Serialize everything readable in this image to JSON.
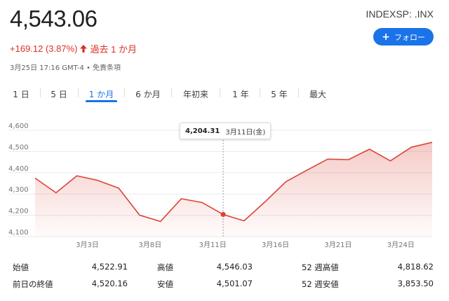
{
  "header": {
    "price": "4,543.06",
    "ticker": "INDEXSP: .INX",
    "follow_label": "フォロー",
    "change_text": "+169.12 (3.87%)",
    "change_period": "過去 1 か月",
    "timestamp": "3月25日 17:16 GMT-4 • 免責条項"
  },
  "tabs": [
    {
      "label": "1 日"
    },
    {
      "label": "5 日"
    },
    {
      "label": "1 か月",
      "active": true
    },
    {
      "label": "6 か月"
    },
    {
      "label": "年初来"
    },
    {
      "label": "1 年"
    },
    {
      "label": "5 年"
    },
    {
      "label": "最大"
    }
  ],
  "tooltip": {
    "value": "4,204.31",
    "date": "3月11日(金)"
  },
  "colors": {
    "line": "#db4437",
    "accent": "#1a73e8",
    "down_text": "#d93025"
  },
  "chart_data": {
    "type": "area",
    "x": [
      "2/25",
      "2/28",
      "3/1",
      "3/2",
      "3/3",
      "3/4",
      "3/7",
      "3/8",
      "3/9",
      "3/10",
      "3/11",
      "3/14",
      "3/15",
      "3/16",
      "3/17",
      "3/18",
      "3/21",
      "3/22",
      "3/23",
      "3/24",
      "3/25"
    ],
    "values": [
      4375,
      4306,
      4386,
      4364,
      4328,
      4201,
      4171,
      4278,
      4260,
      4204,
      4174,
      4263,
      4358,
      4412,
      4464,
      4462,
      4511,
      4456,
      4520,
      4543
    ],
    "ylim": [
      4100,
      4600
    ],
    "yticks": [
      "4,600",
      "4,500",
      "4,400",
      "4,300",
      "4,200",
      "4,100"
    ],
    "ytick_values": [
      4600,
      4500,
      4400,
      4300,
      4200,
      4100
    ],
    "xticks": [
      {
        "label": "3月3日",
        "index": 2.5
      },
      {
        "label": "3月8日",
        "index": 5.5
      },
      {
        "label": "3月11日",
        "index": 8.5
      },
      {
        "label": "3月16日",
        "index": 11.5
      },
      {
        "label": "3月21日",
        "index": 14.5
      },
      {
        "label": "3月24日",
        "index": 17.5
      }
    ],
    "highlight_index": 9,
    "grid": true
  },
  "stats": [
    {
      "label": "始値",
      "value": "4,522.91"
    },
    {
      "label": "前日の終値",
      "value": "4,520.16"
    },
    {
      "label": "高値",
      "value": "4,546.03"
    },
    {
      "label": "安値",
      "value": "4,501.07"
    },
    {
      "label": "52 週高値",
      "value": "4,818.62"
    },
    {
      "label": "52 週安値",
      "value": "3,853.50"
    }
  ]
}
